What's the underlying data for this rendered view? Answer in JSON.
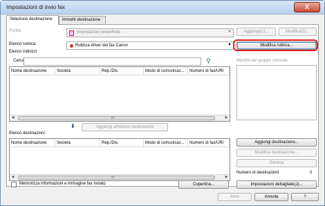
{
  "window": {
    "title": "Impostazioni di invio fax",
    "close_glyph": "X"
  },
  "tabs": [
    {
      "label": "Selezione destinazione",
      "active": true
    },
    {
      "label": "Immetti destinazione",
      "active": false
    }
  ],
  "profile": {
    "label": "Profilo:",
    "value": "Impostazioni predefinite",
    "add_label": "Aggiungi(1)...",
    "edit_label": "Modifica(2)..."
  },
  "address_book": {
    "label": "Elenco rubrica:",
    "value": "Rubrica driver del fax Canon",
    "edit_button": "Modifica rubrica..."
  },
  "address_list": {
    "label": "Elenco indirizzi",
    "search_label": "Cerca:",
    "search_value": "",
    "search_icon": "magnifier-icon",
    "columns": [
      "Nome destinazione",
      "Società",
      "Rep./Div.",
      "Modo di comunicaz...",
      "Numero di fax/URI"
    ],
    "scroll_grip": "III"
  },
  "group_members": {
    "label": "Membri del gruppo corrente:"
  },
  "add_to_list": {
    "label": "Aggiungi all'elenco destinazioni",
    "arrow": "⬇"
  },
  "destinations": {
    "label": "Elenco destinazioni:",
    "columns": [
      "Nome destinazione",
      "Società",
      "Rep./Div.",
      "Modo di comunicaz...",
      "Numero di fax/URI"
    ],
    "scroll_grip": "III",
    "add_button": "Aggiungi destinazione...",
    "edit_button": "Modifica destinazione...",
    "delete_button": "Elimina",
    "count_label": "Numero di destinazioni:",
    "count_value": "0"
  },
  "footer": {
    "store_checkbox_label": "Memorizza informazioni e immagine fax inviato",
    "cover_button": "Copertina...",
    "details_button": "Impostazioni dettagliate(J)...",
    "send_button": "Invia",
    "cancel_button": "Annulla",
    "help_button": "?"
  },
  "colors": {
    "accent_red": "#e02020",
    "title_bg": "#c9dcf2"
  }
}
